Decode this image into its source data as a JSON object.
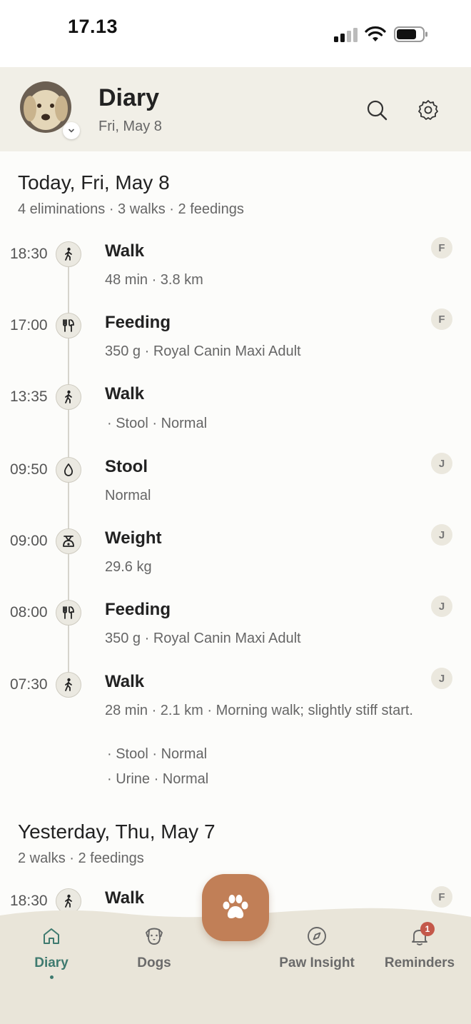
{
  "status": {
    "time": "17.13"
  },
  "header": {
    "title": "Diary",
    "subtitle": "Fri, May 8"
  },
  "today": {
    "title": "Today, Fri, May 8",
    "summary": "4 eliminations · 3 walks · 2 feedings",
    "entries": [
      {
        "time": "18:30",
        "icon": "walk-icon",
        "title": "Walk",
        "detail": "48 min · 3.8 km",
        "badge": "F"
      },
      {
        "time": "17:00",
        "icon": "feeding-icon",
        "title": "Feeding",
        "detail": "350 g · Royal Canin Maxi Adult",
        "badge": "F"
      },
      {
        "time": "13:35",
        "icon": "walk-icon",
        "title": "Walk",
        "sub1": "· Stool · Normal"
      },
      {
        "time": "09:50",
        "icon": "stool-icon",
        "title": "Stool",
        "detail": "Normal",
        "badge": "J"
      },
      {
        "time": "09:00",
        "icon": "weight-icon",
        "title": "Weight",
        "detail": "29.6 kg",
        "badge": "J"
      },
      {
        "time": "08:00",
        "icon": "feeding-icon",
        "title": "Feeding",
        "detail": "350 g · Royal Canin Maxi Adult",
        "badge": "J"
      },
      {
        "time": "07:30",
        "icon": "walk-icon",
        "title": "Walk",
        "detail": "28 min · 2.1 km · Morning walk; slightly stiff start.",
        "sub1": "· Stool · Normal",
        "sub2": "· Urine · Normal",
        "badge": "J"
      }
    ]
  },
  "yesterday": {
    "title": "Yesterday, Thu, May 7",
    "summary": "2 walks · 2 feedings",
    "entries": [
      {
        "time": "18:30",
        "icon": "walk-icon",
        "title": "Walk",
        "badge": "F"
      }
    ]
  },
  "nav": {
    "items": [
      {
        "label": "Diary",
        "icon": "home-icon",
        "active": true
      },
      {
        "label": "Dogs",
        "icon": "dog-icon"
      },
      {
        "label": "Paw Insight",
        "icon": "compass-icon"
      },
      {
        "label": "Reminders",
        "icon": "bell-icon",
        "badge": "1"
      }
    ],
    "fab_icon": "paw-icon"
  },
  "colors": {
    "accent": "#3e7a6f",
    "fab": "#c17f57",
    "header_bg": "#f1efe7",
    "badge_red": "#c4584a"
  }
}
